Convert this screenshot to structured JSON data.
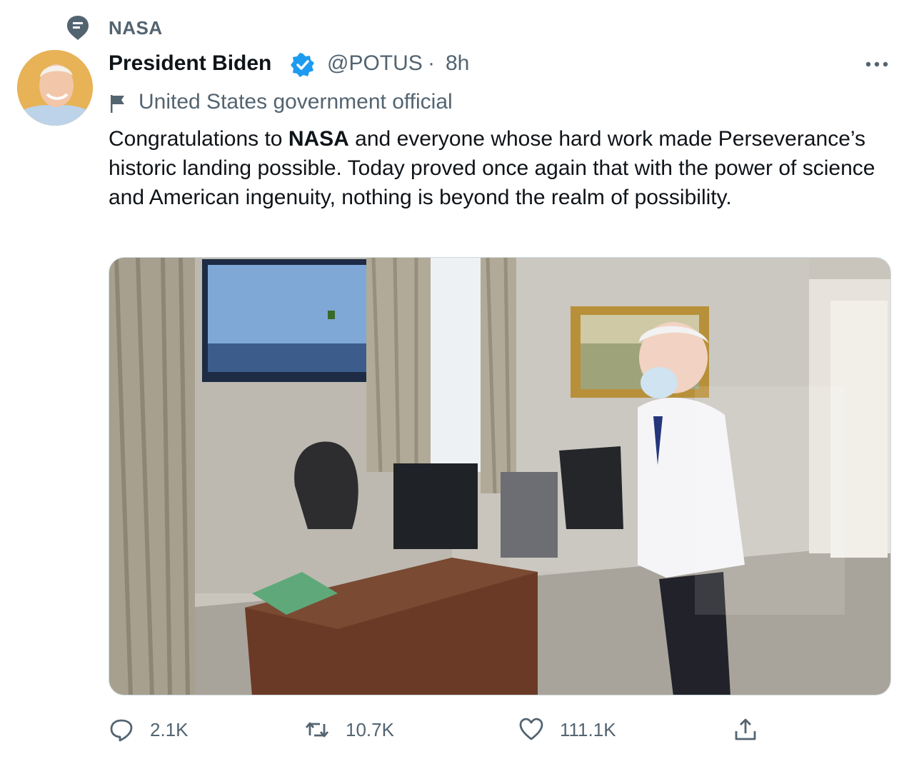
{
  "context": {
    "label": "NASA",
    "icon": "topic-icon"
  },
  "author": {
    "name": "President Biden",
    "handle": "@POTUS",
    "separator": "·",
    "time": "8h",
    "verified": true,
    "avatar": "avatar"
  },
  "label": {
    "text": "United States government official",
    "icon": "flag-icon"
  },
  "tweet": {
    "text_before": "Congratulations to ",
    "text_bold": "NASA",
    "text_after": " and everyone whose hard work made Perseverance’s historic landing possible. Today proved once again that with the power of science and American ingenuity, nothing is beyond the realm of possibility."
  },
  "media": {
    "icon": "photo"
  },
  "actions": {
    "reply": {
      "count": "2.1K",
      "icon": "reply-icon"
    },
    "retweet": {
      "count": "10.7K",
      "icon": "retweet-icon"
    },
    "like": {
      "count": "111.1K",
      "icon": "heart-icon"
    },
    "share": {
      "icon": "share-icon"
    }
  },
  "colors": {
    "verified": "#1d9bf0",
    "secondary_text": "#536471",
    "primary_text": "#0f1419"
  }
}
